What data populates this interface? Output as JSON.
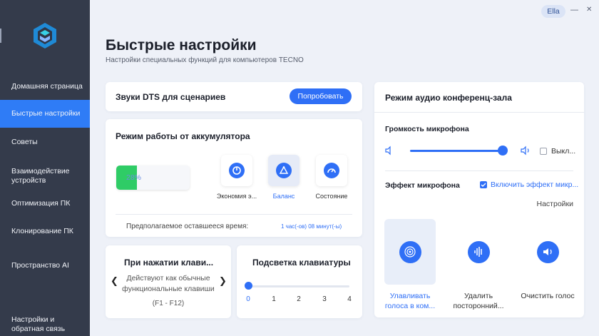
{
  "window": {
    "user": "Ella",
    "minimize": "—",
    "maximize": "☐",
    "close": "✕"
  },
  "sidebar": {
    "items": [
      {
        "label": "Домашняя страница"
      },
      {
        "label": "Быстрые настройки"
      },
      {
        "label": "Советы"
      },
      {
        "label": "Взаимодействие устройств"
      },
      {
        "label": "Оптимизация ПК"
      },
      {
        "label": "Клонирование ПК"
      },
      {
        "label": "Пространство AI"
      },
      {
        "label": "Настройки и обратная связь"
      }
    ]
  },
  "header": {
    "title": "Быстрые настройки",
    "subtitle": "Настройки специальных функций для компьютеров TECNO"
  },
  "dts": {
    "title": "Звуки DTS для сценариев",
    "button": "Попробовать"
  },
  "battery": {
    "title": "Режим работы от аккумулятора",
    "percent_label": "28%",
    "level": 0.28,
    "modes": [
      "Экономия э...",
      "Баланс",
      "Состояние"
    ],
    "selected_mode": "Баланс",
    "remaining_label": "Предполагаемое оставшееся время:",
    "remaining_value": "1 час(-ов) 08 минут(-ы)"
  },
  "fn_keys": {
    "title": "При нажатии клави...",
    "description": "Действуют как обычные функциональные клавиши",
    "hint": "(F1 - F12)",
    "prev": "❮",
    "next": "❯"
  },
  "backlight": {
    "title": "Подсветка клавиатуры",
    "ticks": [
      "0",
      "1",
      "2",
      "3",
      "4"
    ],
    "value": 0
  },
  "conference": {
    "title": "Режим аудио конференц-зала",
    "mic_volume_label": "Громкость микрофона",
    "mic_volume_level": 0.95,
    "off_label": "Выкл...",
    "mic_effect_label": "Эффект микрофона",
    "enable_effect_label": "Включить эффект микр...",
    "settings_label": "Настройки",
    "effects": [
      "Улавливать голоса в ком...",
      "Удалить посторонний...",
      "Очистить голос"
    ],
    "selected_effect": "Улавливать голоса в ком..."
  },
  "colors": {
    "accent": "#2f6ff6",
    "sidebar": "#343b4b",
    "battery": "#2fcc66"
  }
}
